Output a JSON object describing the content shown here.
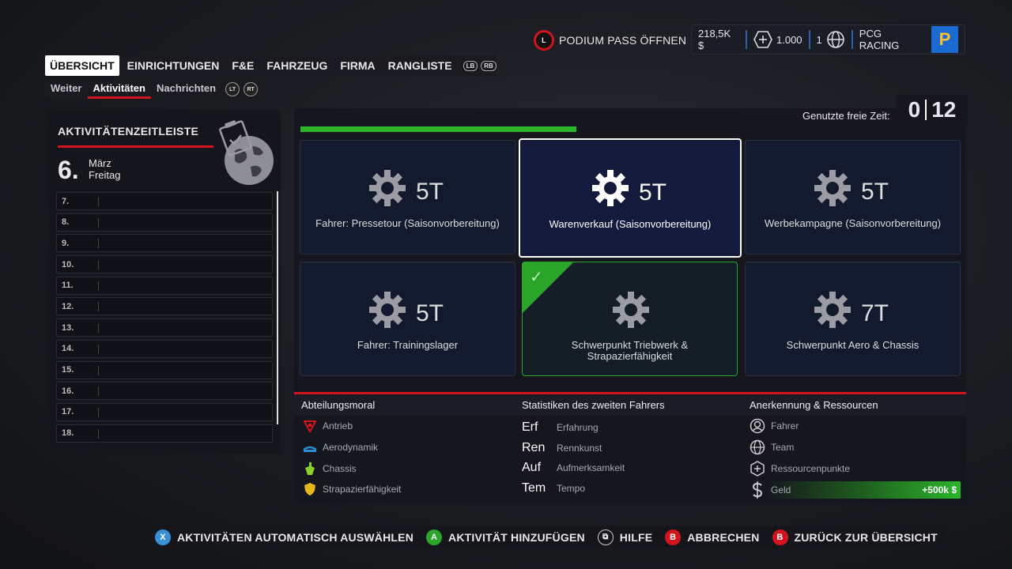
{
  "colors": {
    "accent_red": "#d3141c",
    "progress_green": "#2bb52b",
    "team_blue": "#1b6ad1"
  },
  "top": {
    "podium_button_glyph": "L",
    "podium_label": "PODIUM PASS ÖFFNEN",
    "money": "218,5K $",
    "points": "1.000",
    "count": "1",
    "team_name": "PCG RACING",
    "team_logo_text": "P"
  },
  "tabs": [
    "ÜBERSICHT",
    "EINRICHTUNGEN",
    "F&E",
    "FAHRZEUG",
    "FIRMA",
    "RANGLISTE"
  ],
  "tab_hints": [
    "LB",
    "RB"
  ],
  "subtabs": [
    "Weiter",
    "Aktivitäten",
    "Nachrichten"
  ],
  "subtab_hints": [
    "LT",
    "RT"
  ],
  "timeline": {
    "title": "AKTIVITÄTENZEITLEISTE",
    "day_number": "6.",
    "month": "März",
    "weekday": "Freitag",
    "days": [
      "7.",
      "8.",
      "9.",
      "10.",
      "11.",
      "12.",
      "13.",
      "14.",
      "15.",
      "16.",
      "17.",
      "18."
    ]
  },
  "free_time": {
    "label": "Genutzte freie Zeit:",
    "used": "0",
    "total": "12"
  },
  "activities": [
    {
      "days": "5T",
      "label": "Fahrer: Pressetour (Saisonvorbereitung)",
      "state": "normal"
    },
    {
      "days": "5T",
      "label": "Warenverkauf (Saisonvorbereitung)",
      "state": "selected"
    },
    {
      "days": "5T",
      "label": "Werbekampagne (Saisonvorbereitung)",
      "state": "normal"
    },
    {
      "days": "5T",
      "label": "Fahrer: Trainingslager",
      "state": "normal"
    },
    {
      "days": "",
      "label": "Schwerpunkt Triebwerk & Strapazierfähigkeit",
      "state": "done"
    },
    {
      "days": "7T",
      "label": "Schwerpunkt Aero & Chassis",
      "state": "normal"
    }
  ],
  "morale": {
    "title": "Abteilungsmoral",
    "items": [
      {
        "icon": "engine-icon",
        "label": "Antrieb"
      },
      {
        "icon": "aero-icon",
        "label": "Aerodynamik"
      },
      {
        "icon": "chassis-icon",
        "label": "Chassis"
      },
      {
        "icon": "shield-icon",
        "label": "Strapazierfähigkeit"
      }
    ]
  },
  "driver_stats": {
    "title": "Statistiken des zweiten Fahrers",
    "items": [
      {
        "abbr": "Erf",
        "label": "Erfahrung"
      },
      {
        "abbr": "Ren",
        "label": "Rennkunst"
      },
      {
        "abbr": "Auf",
        "label": "Aufmerksamkeit"
      },
      {
        "abbr": "Tem",
        "label": "Tempo"
      }
    ]
  },
  "resources": {
    "title": "Anerkennung & Ressourcen",
    "items": [
      {
        "icon": "driver-icon",
        "label": "Fahrer"
      },
      {
        "icon": "globe-icon",
        "label": "Team"
      },
      {
        "icon": "plus-hex-icon",
        "label": "Ressourcenpunkte"
      },
      {
        "icon": "dollar-icon",
        "label": "Geld"
      }
    ],
    "money_gain": "+500k $"
  },
  "footer": [
    {
      "glyph": "X",
      "color": "#3a8fd6",
      "label": "AKTIVITÄTEN AUTOMATISCH AUSWÄHLEN"
    },
    {
      "glyph": "A",
      "color": "#2aa52a",
      "label": "AKTIVITÄT HINZUFÜGEN"
    },
    {
      "glyph": "⧉",
      "color": "#15161b",
      "label": "HILFE"
    },
    {
      "glyph": "B",
      "color": "#d3141c",
      "label": "ABBRECHEN"
    },
    {
      "glyph": "B",
      "color": "#d3141c",
      "label": "ZURÜCK ZUR ÜBERSICHT"
    }
  ]
}
